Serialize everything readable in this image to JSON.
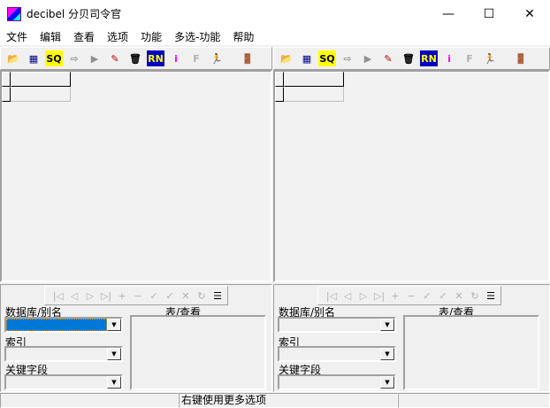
{
  "window": {
    "title": "decibel 分贝司令官",
    "minimize": "—",
    "maximize": "☐",
    "close": "✕"
  },
  "menu": [
    "文件",
    "编辑",
    "查看",
    "选项",
    "功能",
    "多选-功能",
    "帮助"
  ],
  "toolbar": [
    {
      "name": "open-folder-icon",
      "glyph": "📂",
      "color": "#c8b400"
    },
    {
      "name": "table-icon",
      "glyph": "▦",
      "color": "#000080"
    },
    {
      "name": "sql-icon",
      "glyph": "SQ",
      "color": "#000",
      "bg": "#ffff00"
    },
    {
      "name": "arrow-right-icon",
      "glyph": "⇨",
      "color": "#909090"
    },
    {
      "name": "export-icon",
      "glyph": "▶",
      "color": "#909090"
    },
    {
      "name": "edit-brush-icon",
      "glyph": "✎",
      "color": "#c00000"
    },
    {
      "name": "trash-icon",
      "glyph": "🗑",
      "color": "#000"
    },
    {
      "name": "run-icon",
      "glyph": "RN",
      "color": "#ff0",
      "bg": "#0000c0"
    },
    {
      "name": "info-icon",
      "glyph": "i",
      "color": "#ff00ff"
    },
    {
      "name": "filter-icon",
      "glyph": "F",
      "color": "#b0b0b0"
    },
    {
      "name": "runner-icon",
      "glyph": "🏃",
      "color": "#00a000"
    },
    {
      "name": "exit-door-icon",
      "glyph": "🚪",
      "color": "#c00000"
    }
  ],
  "navigator": [
    "|◁",
    "◁",
    "▷",
    "▷|",
    "+",
    "−",
    "✓",
    "✓",
    "✕",
    "↻",
    "☰"
  ],
  "panes": [
    {
      "db_label": "数据库/别名",
      "table_label": "表/查看",
      "index_label": "索引",
      "key_label": "关键字段",
      "db_selected": true
    },
    {
      "db_label": "数据库/别名",
      "table_label": "表/查看",
      "index_label": "索引",
      "key_label": "关键字段",
      "db_selected": false
    }
  ],
  "status": {
    "hint": "右键使用更多选项"
  }
}
